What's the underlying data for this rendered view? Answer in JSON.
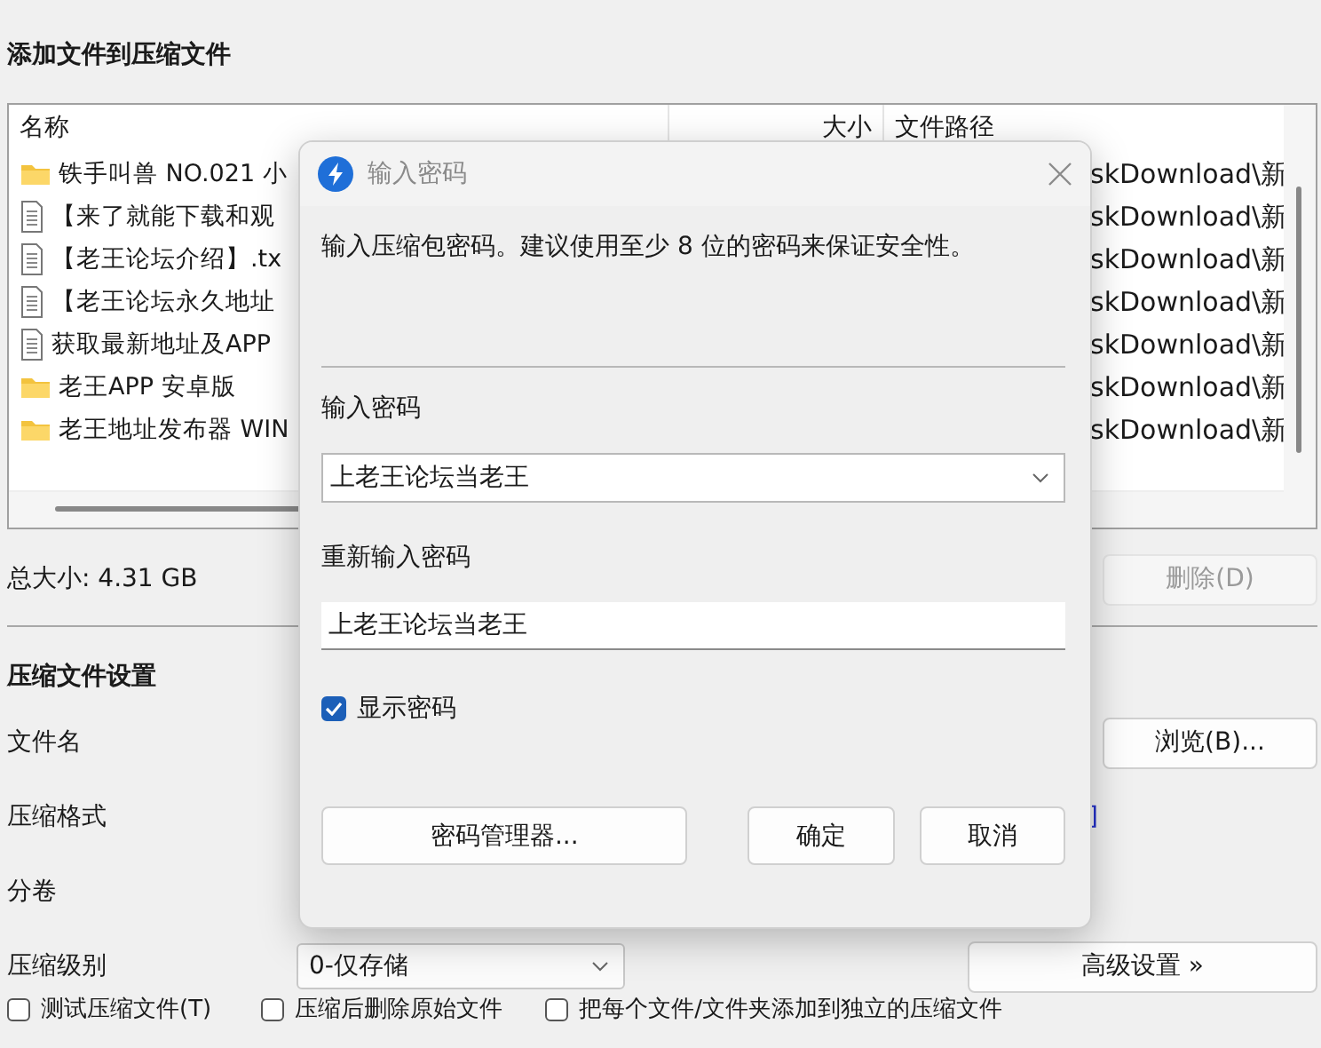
{
  "header": {
    "title": "添加文件到压缩文件"
  },
  "file_list": {
    "columns": [
      {
        "label": "名称"
      },
      {
        "label": "大小"
      },
      {
        "label": "文件路径"
      }
    ],
    "rows": [
      {
        "kind": "folder",
        "name": "铁手叫兽 NO.021 小",
        "path": "skDownload\\新"
      },
      {
        "kind": "file",
        "name": "【来了就能下载和观",
        "path": "skDownload\\新"
      },
      {
        "kind": "file",
        "name": "【老王论坛介绍】.tx",
        "path": "skDownload\\新"
      },
      {
        "kind": "file",
        "name": "【老王论坛永久地址",
        "path": "skDownload\\新"
      },
      {
        "kind": "file",
        "name": "获取最新地址及APP",
        "path": "skDownload\\新"
      },
      {
        "kind": "folder",
        "name": "老王APP 安卓版",
        "path": "skDownload\\新"
      },
      {
        "kind": "folder",
        "name": "老王地址发布器 WIN",
        "path": "skDownload\\新"
      }
    ]
  },
  "summary": {
    "total_size": "总大小: 4.31 GB",
    "delete_button": {
      "label": "删除(D)",
      "disabled": true
    }
  },
  "settings": {
    "title": "压缩文件设置",
    "filename_label": "文件名",
    "browse_button": "浏览(B)...",
    "format_label": "压缩格式",
    "format_link_tail": "]",
    "split_label": "分卷",
    "level_label": "压缩级别",
    "level_value": "0-仅存储",
    "advanced_button": "高级设置 »",
    "options": [
      {
        "label": "测试压缩文件(T)",
        "checked": false
      },
      {
        "label": "压缩后删除原始文件",
        "checked": false
      },
      {
        "label": "把每个文件/文件夹添加到独立的压缩文件",
        "checked": false
      }
    ]
  },
  "dialog": {
    "title": "输入密码",
    "message": "输入压缩包密码。建议使用至少 8 位的密码来保证安全性。",
    "password_label": "输入密码",
    "password_value": "上老王论坛当老王",
    "confirm_label": "重新输入密码",
    "confirm_value": "上老王论坛当老王",
    "show_password": {
      "label": "显示密码",
      "checked": true
    },
    "buttons": [
      {
        "kind": "wide",
        "label": "密码管理器..."
      },
      {
        "kind": "normal",
        "label": "确定"
      },
      {
        "kind": "normal",
        "label": "取消"
      }
    ]
  }
}
